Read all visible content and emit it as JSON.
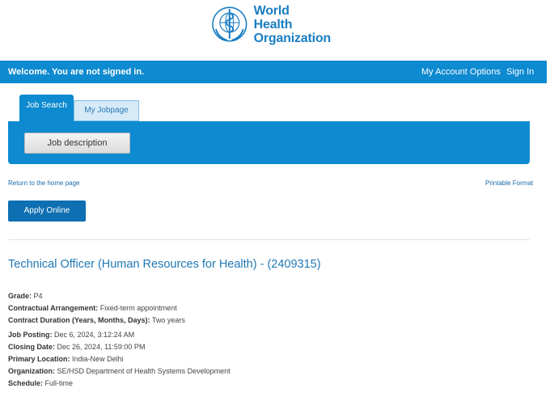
{
  "logo": {
    "line1": "World Health",
    "line2": "Organization",
    "color": "#1a7ec2"
  },
  "topbar": {
    "welcome": "Welcome. You are not signed in.",
    "account_options": "My Account Options",
    "sign_in": "Sign In",
    "color": "#0e8ad0"
  },
  "tabs": [
    {
      "label": "Job Search",
      "active": true
    },
    {
      "label": "My Jobpage",
      "active": false
    }
  ],
  "panel": {
    "job_description_button": "Job description"
  },
  "links": {
    "return_home": "Return to the home page",
    "printable": "Printable Format"
  },
  "apply_button": "Apply Online",
  "job": {
    "title": "Technical Officer (Human Resources for Health) - (2409315)",
    "details": [
      {
        "label": "Grade:",
        "value": "P4"
      },
      {
        "label": "Contractual Arrangement:",
        "value": "Fixed-term appointment"
      },
      {
        "label": "Contract Duration (Years, Months, Days):",
        "value": "Two years"
      },
      {
        "label": "Job Posting:",
        "value": "Dec 6, 2024, 3:12:24 AM"
      },
      {
        "label": "Closing Date:",
        "value": "Dec 26, 2024, 11:59:00 PM"
      },
      {
        "label": "Primary Location:",
        "value": "India-New Delhi"
      },
      {
        "label": "Organization:",
        "value": "SE/HSD Department of Health Systems Development"
      },
      {
        "label": "Schedule:",
        "value": "Full-time"
      }
    ]
  }
}
